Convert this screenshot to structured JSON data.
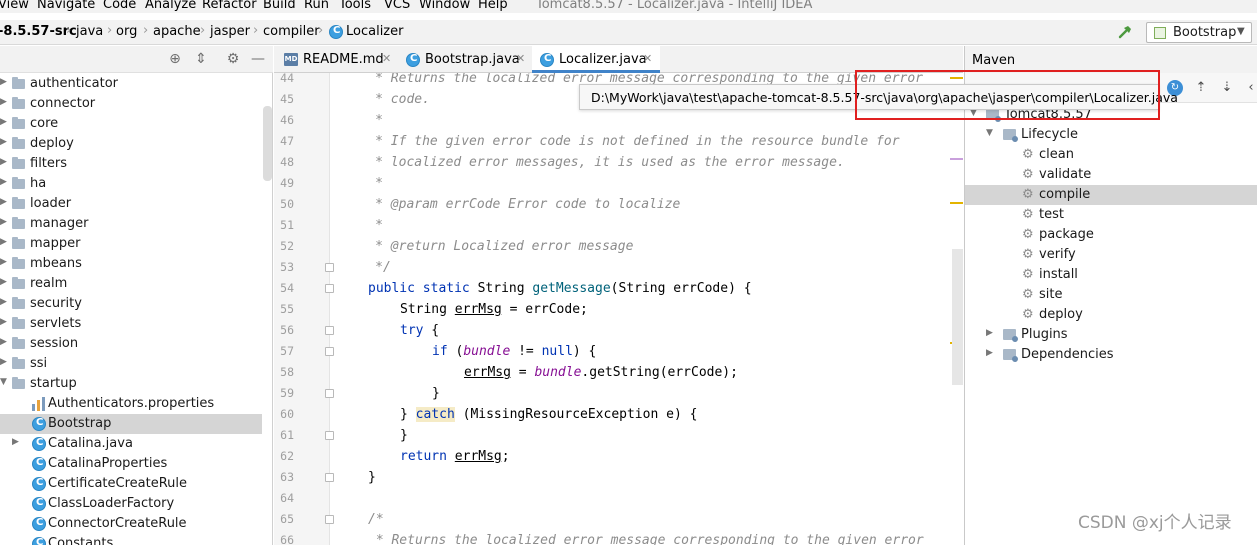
{
  "menu": {
    "items": [
      "View",
      "Navigate",
      "Code",
      "Analyze",
      "Refactor",
      "Build",
      "Run",
      "Tools",
      "VCS",
      "Window",
      "Help"
    ],
    "window_title": "Tomcat8.5.57 - Localizer.java - IntelliJ IDEA"
  },
  "navbar": {
    "breadcrumbs": [
      "-8.5.57-src",
      "java",
      "org",
      "apache",
      "jasper",
      "compiler",
      "Localizer"
    ],
    "run_config": "Bootstrap"
  },
  "project": {
    "tree": [
      {
        "label": "authenticator",
        "kind": "folder"
      },
      {
        "label": "connector",
        "kind": "folder"
      },
      {
        "label": "core",
        "kind": "folder"
      },
      {
        "label": "deploy",
        "kind": "folder"
      },
      {
        "label": "filters",
        "kind": "folder"
      },
      {
        "label": "ha",
        "kind": "folder"
      },
      {
        "label": "loader",
        "kind": "folder"
      },
      {
        "label": "manager",
        "kind": "folder"
      },
      {
        "label": "mapper",
        "kind": "folder"
      },
      {
        "label": "mbeans",
        "kind": "folder"
      },
      {
        "label": "realm",
        "kind": "folder"
      },
      {
        "label": "security",
        "kind": "folder"
      },
      {
        "label": "servlets",
        "kind": "folder"
      },
      {
        "label": "session",
        "kind": "folder"
      },
      {
        "label": "ssi",
        "kind": "folder"
      },
      {
        "label": "startup",
        "kind": "folder-open"
      },
      {
        "label": "Authenticators.properties",
        "kind": "properties"
      },
      {
        "label": "Bootstrap",
        "kind": "class",
        "selected": true
      },
      {
        "label": "Catalina.java",
        "kind": "class"
      },
      {
        "label": "CatalinaProperties",
        "kind": "class"
      },
      {
        "label": "CertificateCreateRule",
        "kind": "class"
      },
      {
        "label": "ClassLoaderFactory",
        "kind": "class"
      },
      {
        "label": "ConnectorCreateRule",
        "kind": "class"
      },
      {
        "label": "Constants",
        "kind": "class"
      }
    ]
  },
  "editor": {
    "tabs": [
      {
        "label": "README.md",
        "active": false
      },
      {
        "label": "Bootstrap.java",
        "active": false
      },
      {
        "label": "Localizer.java",
        "active": true
      }
    ],
    "line_numbers": [
      "44",
      "45",
      "46",
      "47",
      "48",
      "49",
      "50",
      "51",
      "52",
      "53",
      "54",
      "55",
      "56",
      "57",
      "58",
      "59",
      "60",
      "61",
      "62",
      "63",
      "64",
      "65",
      "66"
    ],
    "code": {
      "l44": "     * Returns the localized error message corresponding to the given error",
      "l45": "     * code.",
      "l46": "     *",
      "l47": "     * If the given error code is not defined in the resource bundle for",
      "l48": "     * localized error messages, it is used as the error message.",
      "l49": "     *",
      "l50": "     * @param errCode Error code to localize",
      "l51": "     *",
      "l52": "     * @return Localized error message",
      "l53": "     */",
      "l54_kw1": "public",
      "l54_kw2": "static",
      "l54_type": "String",
      "l54_fn": "getMessage",
      "l54_rest": "(String errCode) {",
      "l55_type": "String",
      "l55_var": "errMsg",
      "l55_rest": " = errCode;",
      "l56_kw": "try",
      "l56_rest": " {",
      "l57_kw": "if",
      "l57_open": " (",
      "l57_fld": "bundle",
      "l57_op": " != ",
      "l57_null": "null",
      "l57_rest": ") {",
      "l58_var": "errMsg",
      "l58_eq": " = ",
      "l58_fld": "bundle",
      "l58_rest": ".getString(errCode);",
      "l59": "}",
      "l60_brace": "} ",
      "l60_kw": "catch",
      "l60_rest": " (MissingResourceException e) {",
      "l61": "}",
      "l62_kw": "return",
      "l62_var": "errMsg",
      "l62_rest": ";",
      "l63": "}",
      "l64": "",
      "l65": "/*",
      "l66": " * Returns the localized error message corresponding to the given error"
    }
  },
  "tooltip": {
    "path": "D:\\MyWork\\java\\test\\apache-tomcat-8.5.57-src\\java\\org\\apache\\jasper\\compiler\\Localizer.java"
  },
  "maven": {
    "title": "Maven",
    "project": "Tomcat8.5.57",
    "lifecycle": "Lifecycle",
    "phases": [
      "clean",
      "validate",
      "compile",
      "test",
      "package",
      "verify",
      "install",
      "site",
      "deploy"
    ],
    "selected_phase": "compile",
    "plugins": "Plugins",
    "dependencies": "Dependencies"
  },
  "watermark": "CSDN @xj个人记录"
}
